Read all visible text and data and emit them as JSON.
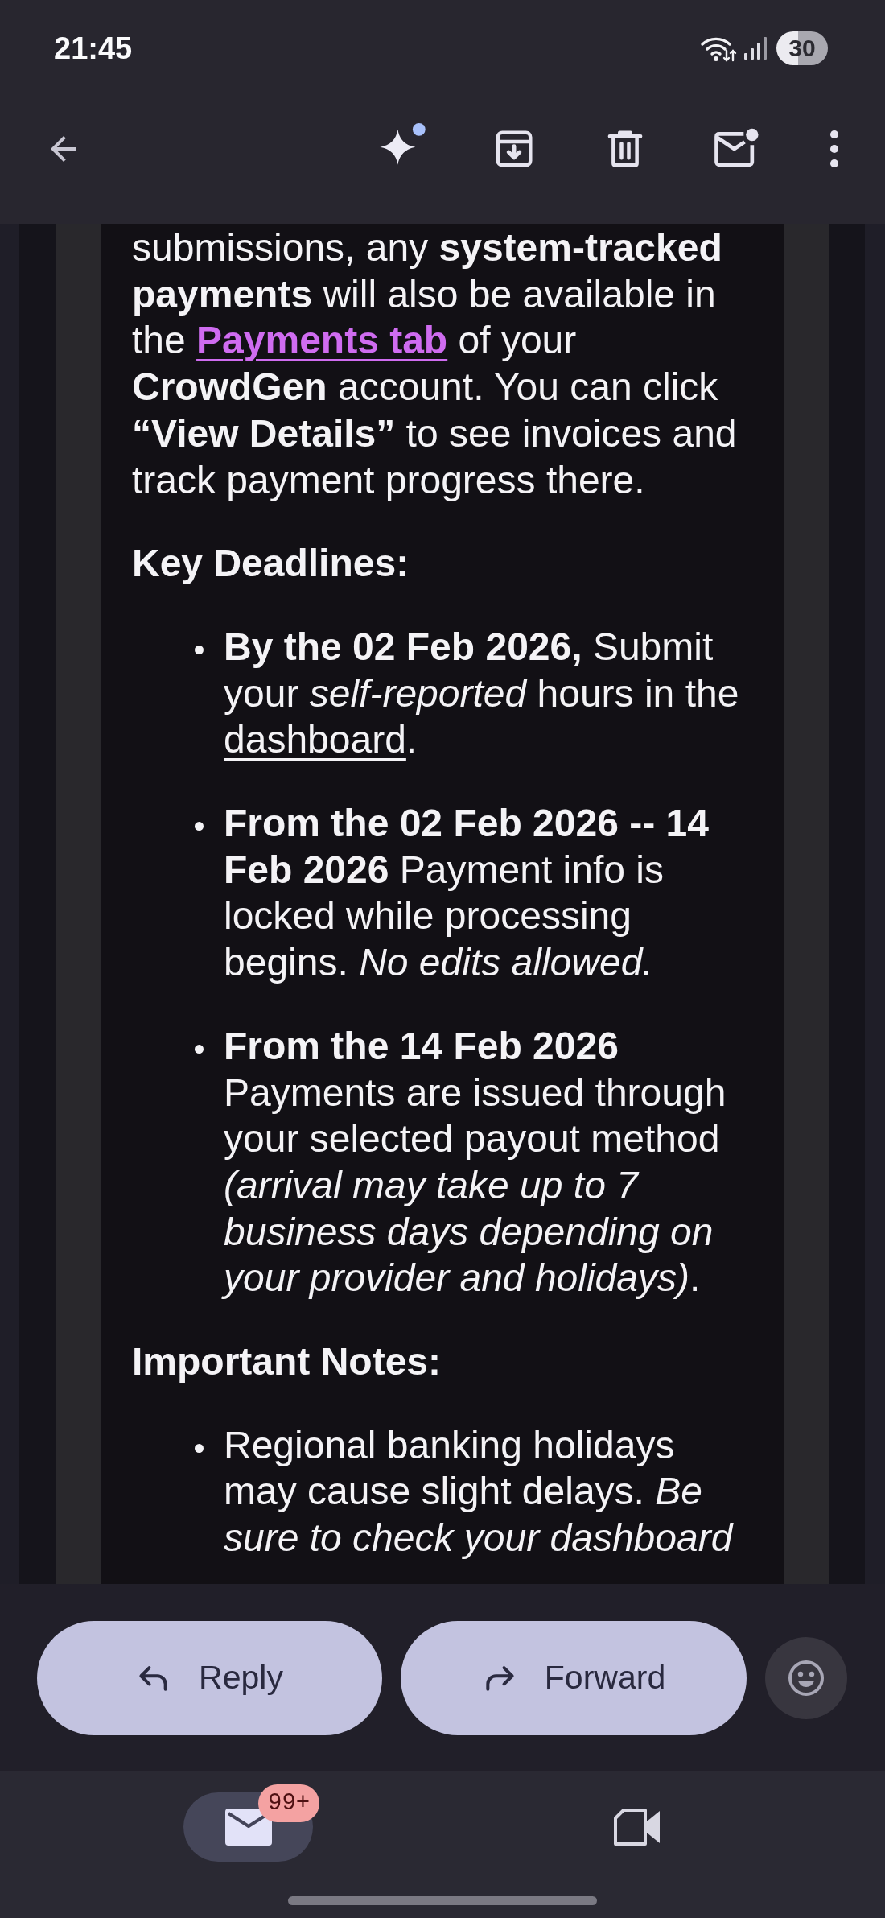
{
  "status_bar": {
    "time": "21:45",
    "battery": "30"
  },
  "message": {
    "blocks": [
      {
        "kind": "paragraph",
        "parts": [
          {
            "kind": "text",
            "text": "submissions, any **system-tracked payments** will also be available in the "
          },
          {
            "kind": "accent_link",
            "text": "Payments tab"
          },
          {
            "kind": "text",
            "text": " of your **CrowdGen** account. You can click **“View Details”** to see invoices and track payment progress there."
          }
        ]
      },
      {
        "kind": "heading",
        "text": "Key Deadlines:"
      },
      {
        "kind": "list",
        "items": [
          {
            "parts": [
              {
                "kind": "text",
                "text": "**By the 02 Feb 2026,** Submit your *self-reported* hours in the "
              },
              {
                "kind": "link",
                "text": "dashboard"
              },
              {
                "kind": "text",
                "text": "."
              }
            ]
          },
          {
            "parts": [
              {
                "kind": "text",
                "text": "**From the 02 Feb 2026 -- 14 Feb 2026** Payment info is locked while processing begins. *No edits allowed.*"
              }
            ]
          },
          {
            "parts": [
              {
                "kind": "text",
                "text": "**From the 14 Feb 2026** Payments are issued through your selected payout method *(arrival may take up to 7 business days depending on your provider and holidays)*."
              }
            ]
          }
        ]
      },
      {
        "kind": "heading",
        "text": "Important Notes:"
      },
      {
        "kind": "list",
        "items": [
          {
            "parts": [
              {
                "kind": "text",
                "text": "Regional banking holidays may cause slight delays. *Be sure to check your dashboard*"
              }
            ]
          }
        ]
      }
    ]
  },
  "actions": [
    {
      "kind": "reply",
      "label": "Reply"
    },
    {
      "kind": "forward",
      "label": "Forward"
    },
    {
      "kind": "emoji"
    }
  ],
  "bottom_nav": [
    {
      "kind": "mail",
      "selected": true,
      "badge": "99+"
    },
    {
      "kind": "meet",
      "selected": false
    }
  ]
}
